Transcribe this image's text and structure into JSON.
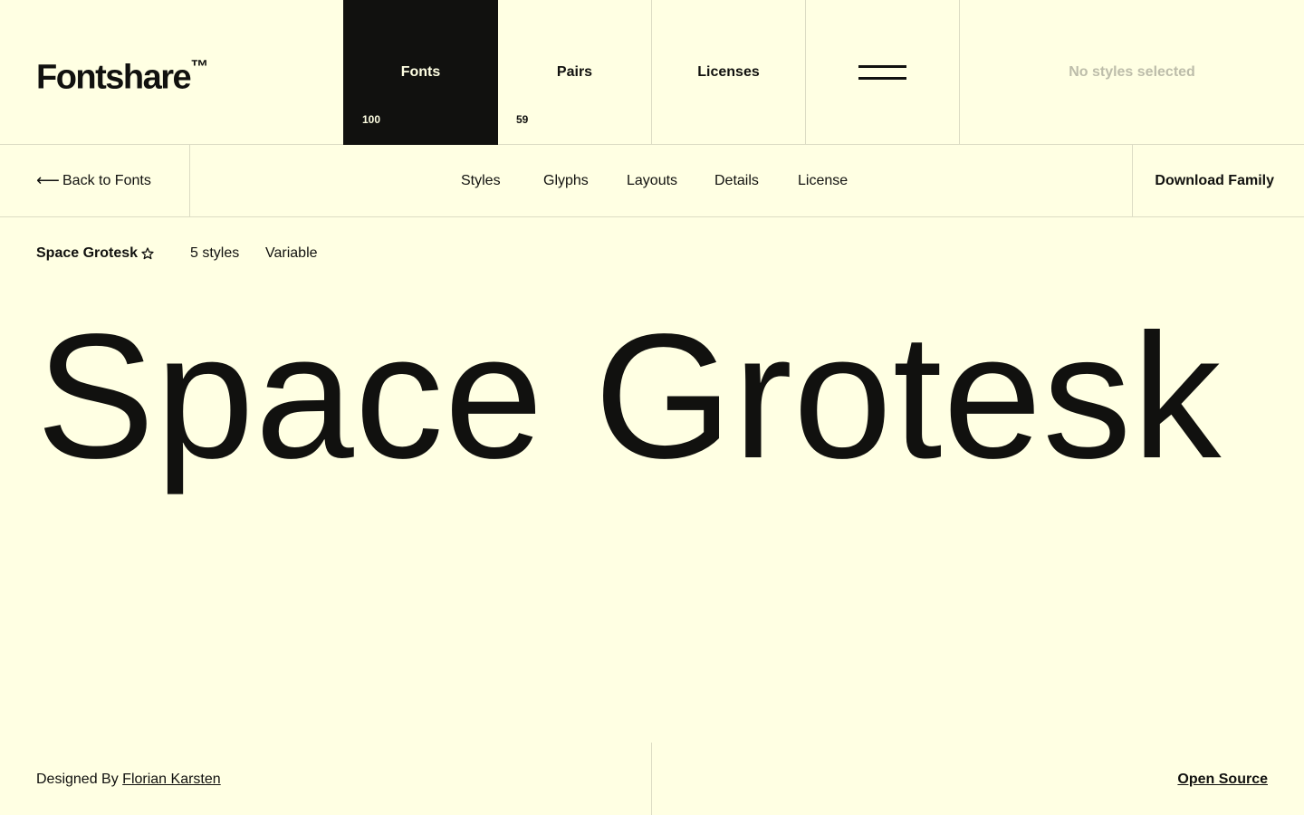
{
  "header": {
    "logo": "Fontshare",
    "logo_mark": "™",
    "nav": [
      {
        "label": "Fonts",
        "count": "100",
        "active": true
      },
      {
        "label": "Pairs",
        "count": "59"
      },
      {
        "label": "Licenses",
        "count": ""
      }
    ],
    "menu_icon": "hamburger-icon",
    "styles_status": "No styles selected"
  },
  "subnav": {
    "back_icon": "arrow-left-icon",
    "back_arrow": "⟵",
    "back_label": "Back to Fonts",
    "tabs": [
      "Styles",
      "Glyphs",
      "Layouts",
      "Details",
      "License"
    ],
    "download_label": "Download Family"
  },
  "font": {
    "name": "Space Grotesk",
    "favorite_icon": "star-outline-icon",
    "styles_count": "5 styles",
    "type": "Variable",
    "specimen": "Space Grotesk"
  },
  "footer": {
    "designed_by_prefix": "Designed By",
    "designer": "Florian Karsten",
    "license_type": "Open Source"
  },
  "colors": {
    "background": "#ffffe3",
    "ink": "#11110f",
    "muted": "#bdbdaa",
    "divider": "#dcdcc4"
  }
}
